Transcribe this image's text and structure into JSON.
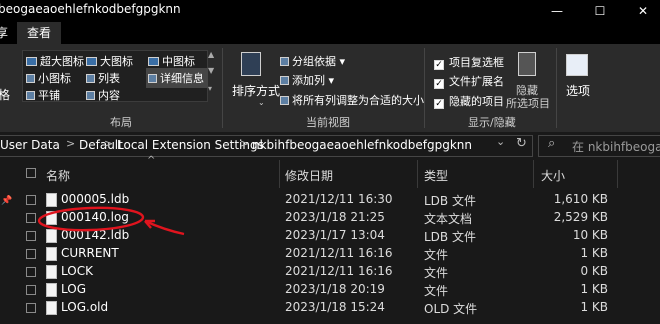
{
  "window": {
    "title": "beogaeaoehlefnkodbefgpgknn"
  },
  "window_controls": {
    "minimize": "—",
    "maximize": "☐",
    "close": "✕"
  },
  "tabs": [
    {
      "label": "享"
    },
    {
      "label": "查看"
    }
  ],
  "ribbon": {
    "layout_group": {
      "label": "布局",
      "left_cutoff": "格",
      "items": [
        {
          "label": "超大图标"
        },
        {
          "label": "大图标"
        },
        {
          "label": "中图标"
        },
        {
          "label": "小图标"
        },
        {
          "label": "列表"
        },
        {
          "label": "详细信息"
        },
        {
          "label": "平铺"
        },
        {
          "label": "内容"
        }
      ]
    },
    "current_view_group": {
      "label": "当前视图",
      "sort_label": "排序方式",
      "group_by": "分组依据",
      "add_column": "添加列",
      "fit_columns": "将所有列调整为合适的大小"
    },
    "show_hide_group": {
      "label": "显示/隐藏",
      "item_checkboxes": "项目复选框",
      "file_extensions": "文件扩展名",
      "hidden_items": "隐藏的项目",
      "hide_selected_line1": "隐藏",
      "hide_selected_line2": "所选项目",
      "checkmark": "✓"
    },
    "options_label": "选项"
  },
  "address": {
    "path": [
      "User Data",
      "Default",
      "Local Extension Settings",
      "nkbihfbeogaeaoehlefnkodbefgpgknn"
    ],
    "separator": ">",
    "dropdown": "⌄",
    "refresh": "↻",
    "search_placeholder": "在 nkbihfbeogaea"
  },
  "columns": {
    "name": "名称",
    "date": "修改日期",
    "type": "类型",
    "size": "大小",
    "sort_arrow": "^"
  },
  "files": [
    {
      "name": "000005.ldb",
      "date": "2021/12/11 16:30",
      "type": "LDB 文件",
      "size": "1,610 KB"
    },
    {
      "name": "000140.log",
      "date": "2023/1/18 21:25",
      "type": "文本文档",
      "size": "2,529 KB"
    },
    {
      "name": "000142.ldb",
      "date": "2023/1/17 13:04",
      "type": "LDB 文件",
      "size": "10 KB"
    },
    {
      "name": "CURRENT",
      "date": "2021/12/11 16:16",
      "type": "文件",
      "size": "1 KB"
    },
    {
      "name": "LOCK",
      "date": "2021/12/11 16:16",
      "type": "文件",
      "size": "0 KB"
    },
    {
      "name": "LOG",
      "date": "2023/1/18 20:19",
      "type": "文件",
      "size": "1 KB"
    },
    {
      "name": "LOG.old",
      "date": "2023/1/18 15:24",
      "type": "OLD 文件",
      "size": "1 KB"
    }
  ],
  "colors": {
    "background": "#191919",
    "ribbon": "#2b2b2b",
    "annotation": "#e0141e"
  }
}
